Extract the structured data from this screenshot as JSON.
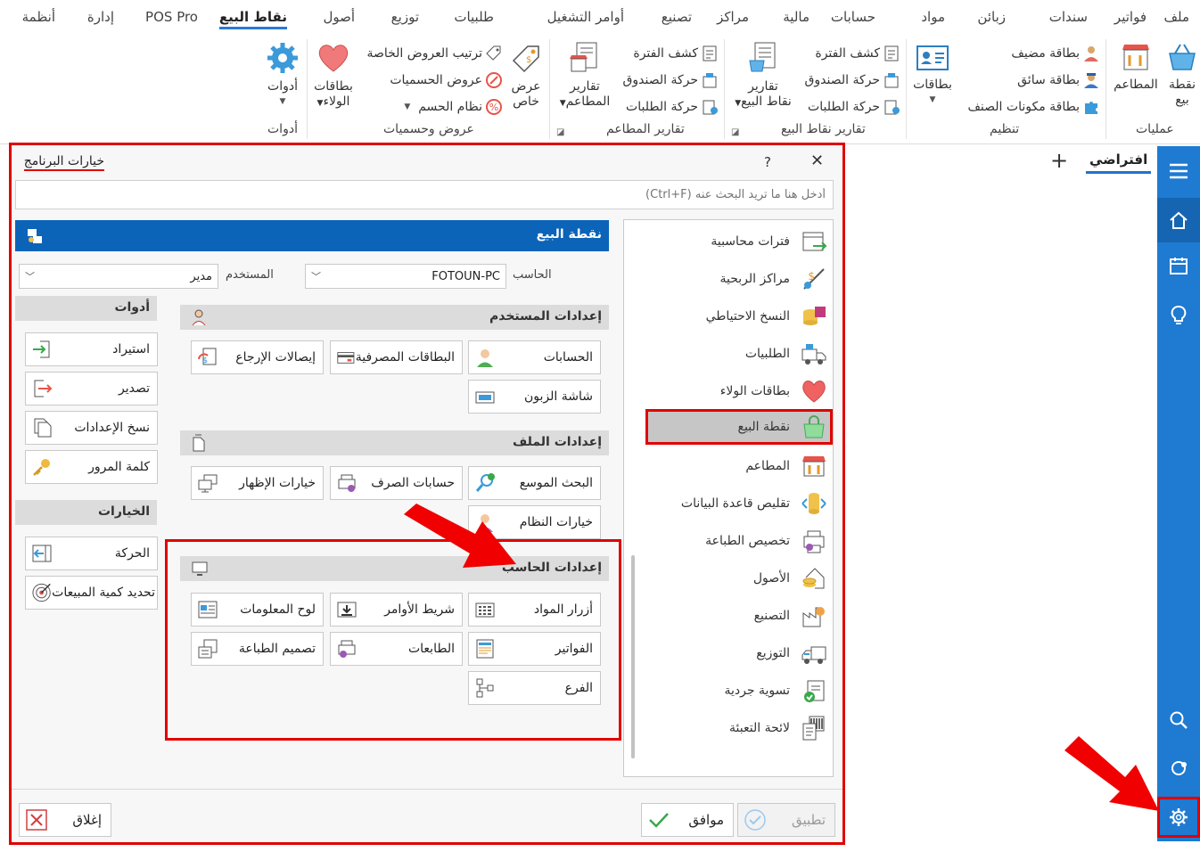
{
  "menu": {
    "tabs": [
      "ملف",
      "فواتير",
      "سندات",
      "زبائن",
      "مواد",
      "حسابات",
      "مالية",
      "مراكز",
      "تصنيع",
      "أوامر التشغيل",
      "طلبيات",
      "توزيع",
      "أصول",
      "نقاط البيع",
      "POS Pro",
      "إدارة",
      "أنظمة"
    ],
    "active_tab": "نقاط البيع"
  },
  "ribbon": {
    "ops": {
      "big1": "نقطة بيع",
      "big2": "المطاعم",
      "label": "عمليات"
    },
    "org": {
      "item1": "بطاقة مضيف",
      "item2": "بطاقة سائق",
      "item3": "بطاقة مكونات الصنف",
      "big": "بطاقات",
      "label": "تنظيم"
    },
    "posreports": {
      "item1": "كشف الفترة",
      "item2": "حركة الصندوق",
      "item3": "حركة الطلبات",
      "big_line1": "تقارير",
      "big_line2": "نقاط البيع",
      "label": "تقارير نقاط البيع"
    },
    "restreports": {
      "item1": "كشف الفترة",
      "item2": "حركة الصندوق",
      "item3": "حركة الطلبات",
      "big_line1": "تقارير",
      "big_line2": "المطاعم",
      "label": "تقارير المطاعم"
    },
    "offers": {
      "item1": "ترتيب العروض الخاصة",
      "item2": "عروض الحسميات",
      "item3": "نظام الحسم",
      "big1_line1": "عرض",
      "big1_line2": "خاص",
      "big2_line1": "بطاقات",
      "big2_line2": "الولاء",
      "label": "عروض وحسميات"
    },
    "tools": {
      "big": "أدوات",
      "label": "أدوات"
    }
  },
  "workspace": {
    "tab_default": "افتراضي",
    "add_tab": "+"
  },
  "dialog": {
    "title": "خيارات البرنامج",
    "help": "?",
    "close": "✕",
    "search_placeholder": "أدخل هنا ما تريد البحث عنه (Ctrl+F)",
    "categories": [
      {
        "label": "فترات محاسبية",
        "icon": "calendar-icon"
      },
      {
        "label": "مراكز الربحية",
        "icon": "profit-center-icon"
      },
      {
        "label": "النسخ الاحتياطي",
        "icon": "backup-icon"
      },
      {
        "label": "الطلبيات",
        "icon": "delivery-truck-icon"
      },
      {
        "label": "بطاقات الولاء",
        "icon": "heart-icon"
      },
      {
        "label": "نقطة البيع",
        "icon": "shopping-bag-icon"
      },
      {
        "label": "المطاعم",
        "icon": "restaurant-icon"
      },
      {
        "label": "تقليص قاعدة البيانات",
        "icon": "database-shrink-icon"
      },
      {
        "label": "تخصيص الطباعة",
        "icon": "printer-settings-icon"
      },
      {
        "label": "الأصول",
        "icon": "assets-icon"
      },
      {
        "label": "التصنيع",
        "icon": "factory-icon"
      },
      {
        "label": "التوزيع",
        "icon": "distribution-truck-icon"
      },
      {
        "label": "تسوية جردية",
        "icon": "inventory-check-icon"
      },
      {
        "label": "لائحة التعبئة",
        "icon": "packing-list-icon"
      }
    ],
    "active_category": "نقطة البيع",
    "pos_header": "نقطة البيع",
    "computer_label": "الحاسب",
    "computer_value": "FOTOUN-PC",
    "user_label": "المستخدم",
    "user_value": "مدير",
    "user_settings": {
      "title": "إعدادات المستخدم",
      "buttons": [
        "الحسابات",
        "البطاقات المصرفية",
        "إيصالات الإرجاع",
        "شاشة الزبون"
      ]
    },
    "file_settings": {
      "title": "إعدادات الملف",
      "buttons": [
        "البحث الموسع",
        "حسابات الصرف",
        "خيارات الإظهار",
        "خيارات النظام"
      ]
    },
    "computer_settings": {
      "title": "إعدادات الحاسب",
      "buttons": [
        "أزرار المواد",
        "شريط الأوامر",
        "لوح المعلومات",
        "الفواتير",
        "الطابعات",
        "تصميم الطباعة",
        "الفرع"
      ]
    },
    "tools": {
      "title": "أدوات",
      "buttons": [
        "استيراد",
        "تصدير",
        "نسخ الإعدادات",
        "كلمة المرور"
      ]
    },
    "options": {
      "title": "الخيارات",
      "buttons": [
        "الحركة",
        "تحديد كمية المبيعات"
      ]
    },
    "footer": {
      "apply": "تطبيق",
      "ok": "موافق",
      "close": "إغلاق"
    }
  },
  "colors": {
    "accent": "#1f7ad1",
    "header_band": "#0b64b8",
    "highlight": "#e00000"
  }
}
